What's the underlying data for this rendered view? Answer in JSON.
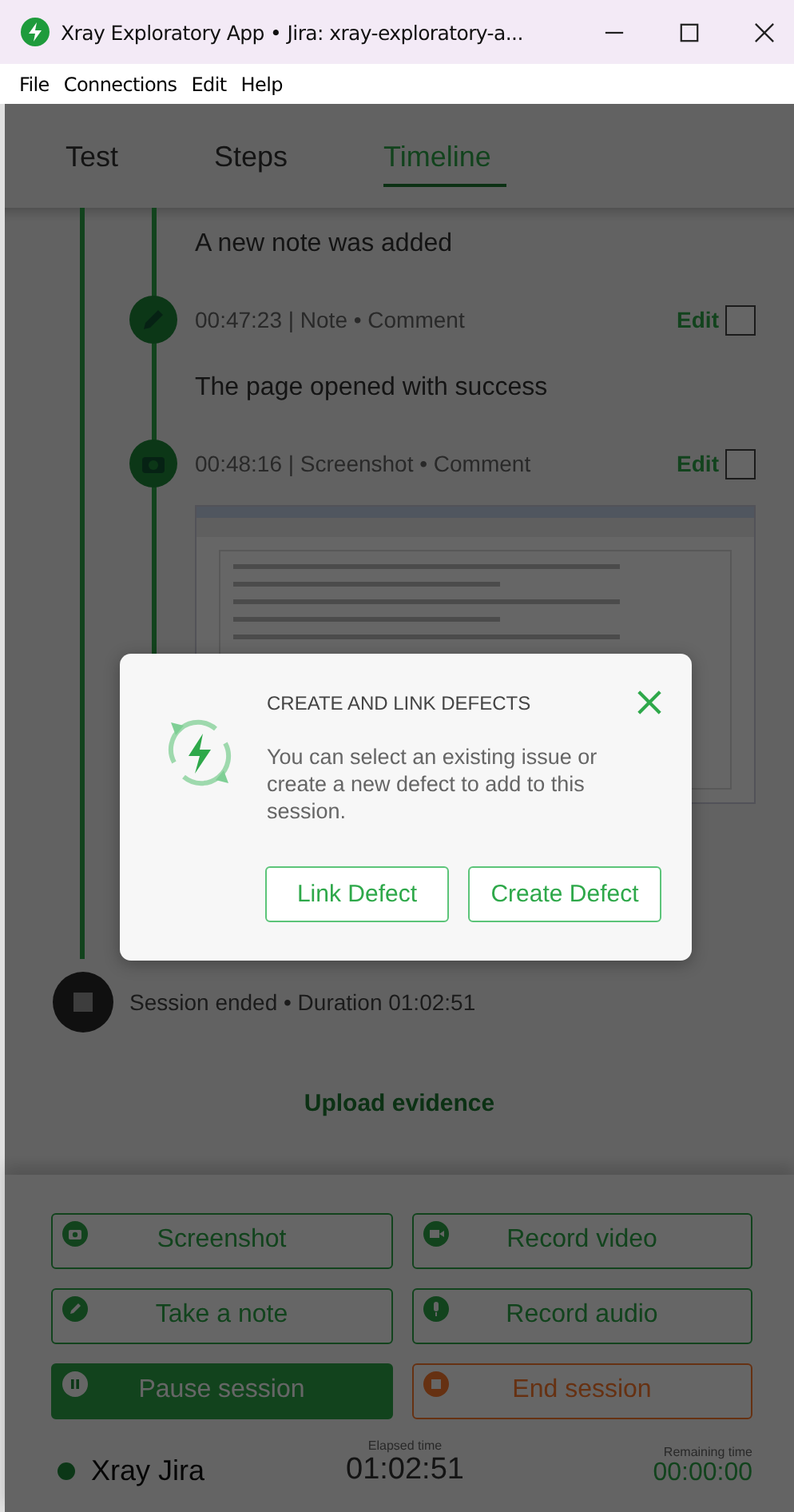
{
  "window": {
    "title": "Xray Exploratory App • Jira: xray-exploratory-a..."
  },
  "menu": [
    "File",
    "Connections",
    "Edit",
    "Help"
  ],
  "tabs": [
    {
      "label": "Test",
      "selected": false
    },
    {
      "label": "Steps",
      "selected": false
    },
    {
      "label": "Timeline",
      "selected": true
    }
  ],
  "timeline": {
    "items": [
      {
        "kind": "text",
        "text": "A new note was added"
      },
      {
        "kind": "note",
        "meta": "00:47:23 | Note • Comment",
        "action": "Edit",
        "checked": false
      },
      {
        "kind": "text",
        "text": "The page opened with success"
      },
      {
        "kind": "screenshot",
        "meta": "00:48:16 | Screenshot • Comment",
        "action": "Edit",
        "checked": false
      },
      {
        "kind": "image"
      }
    ],
    "end": "Session ended • Duration 01:02:51",
    "upload": "Upload evidence"
  },
  "dialog": {
    "title": "CREATE AND LINK DEFECTS",
    "message": "You can select an existing issue or create a new defect to add to this session.",
    "buttons": [
      "Link Defect",
      "Create Defect"
    ]
  },
  "actions": [
    {
      "kind": "screenshot",
      "label": "Screenshot"
    },
    {
      "kind": "video",
      "label": "Record video"
    },
    {
      "kind": "note",
      "label": "Take a note"
    },
    {
      "kind": "audio",
      "label": "Record audio"
    },
    {
      "kind": "pause",
      "label": "Pause session"
    },
    {
      "kind": "end",
      "label": "End session"
    }
  ],
  "footer": {
    "account": "Xray Jira",
    "elapsed_label": "Elapsed time",
    "elapsed": "01:02:51",
    "remaining_label": "Remaining time",
    "remaining": "00:00:00"
  }
}
